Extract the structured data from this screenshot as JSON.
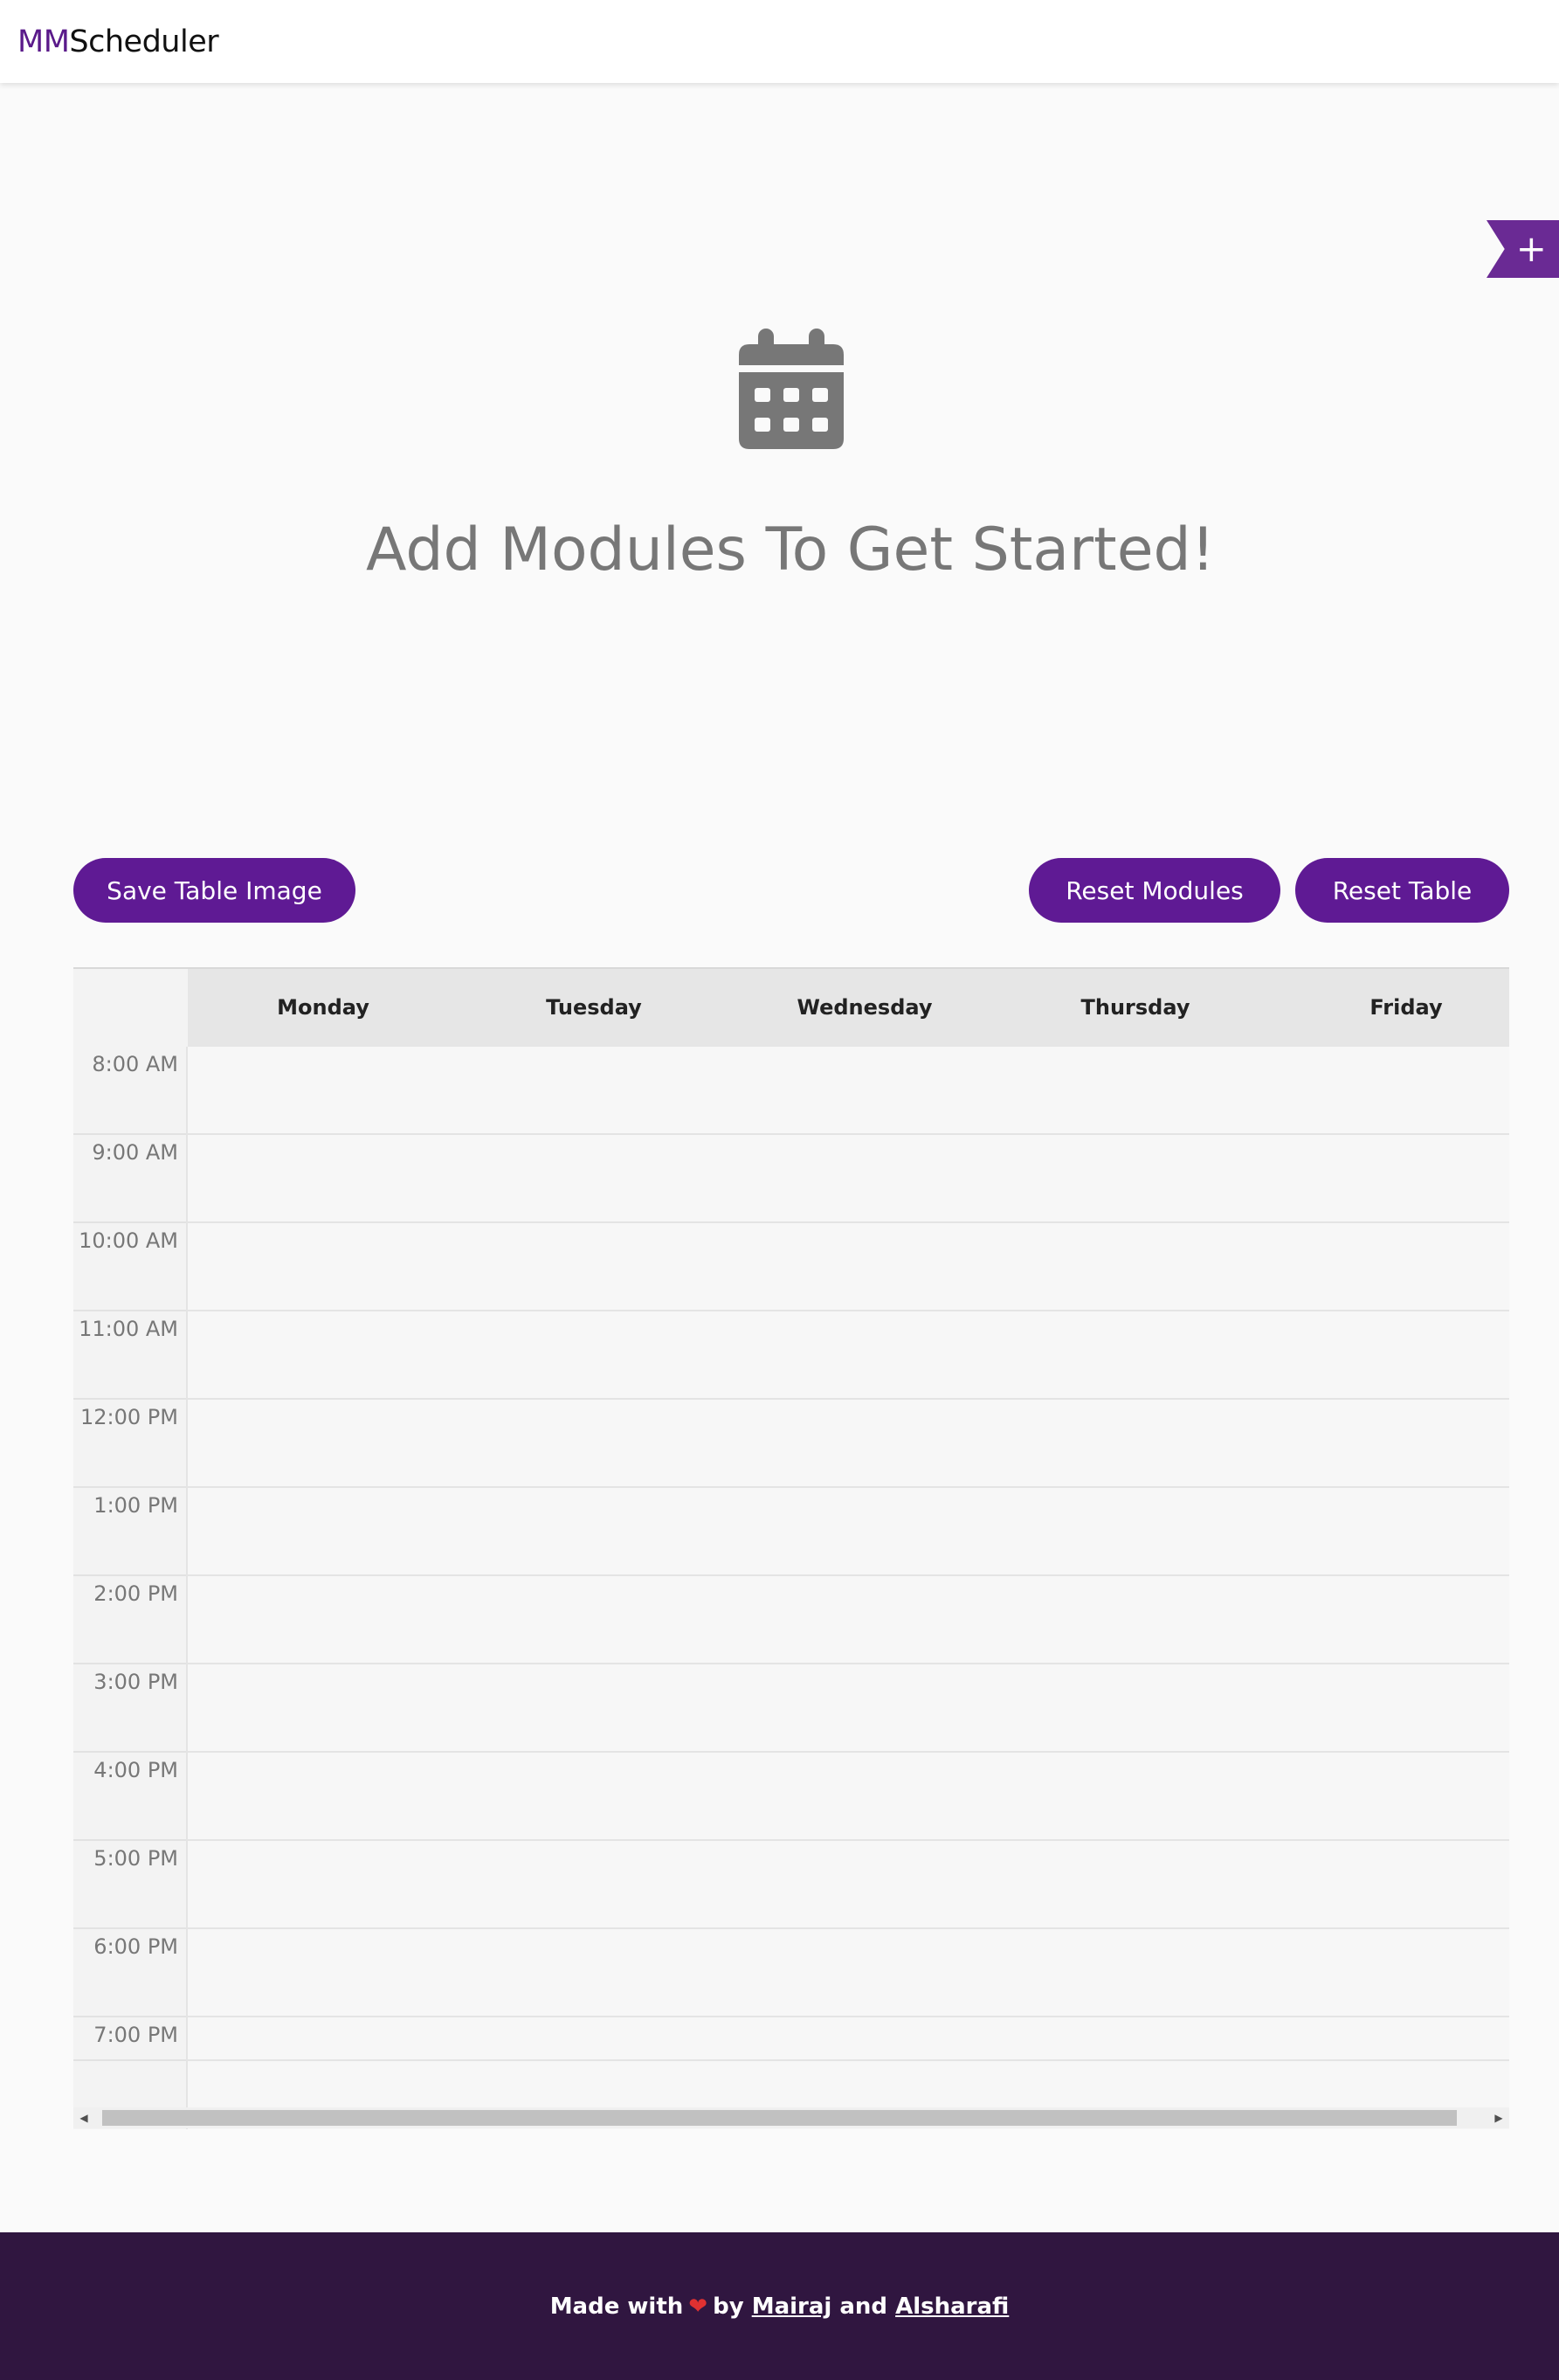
{
  "header": {
    "logo_prefix": "MM",
    "logo_suffix": "Scheduler"
  },
  "add_button": {
    "label": "+"
  },
  "empty_state": {
    "icon": "calendar-icon",
    "title": "Add Modules To Get Started!"
  },
  "actions": {
    "save_label": "Save Table Image",
    "reset_modules_label": "Reset Modules",
    "reset_table_label": "Reset Table"
  },
  "timetable": {
    "days": [
      "Monday",
      "Tuesday",
      "Wednesday",
      "Thursday",
      "Friday"
    ],
    "times": [
      "8:00 AM",
      "9:00 AM",
      "10:00 AM",
      "11:00 AM",
      "12:00 PM",
      "1:00 PM",
      "2:00 PM",
      "3:00 PM",
      "4:00 PM",
      "5:00 PM",
      "6:00 PM",
      "7:00 PM"
    ]
  },
  "footer": {
    "text_before": "Made with",
    "heart": "❤",
    "by": "by",
    "author1": "Mairaj",
    "and": "and",
    "author2": "Alsharafi"
  },
  "colors": {
    "brand_purple": "#5f1a94",
    "footer_bg": "#301640",
    "muted_text": "#777777"
  }
}
